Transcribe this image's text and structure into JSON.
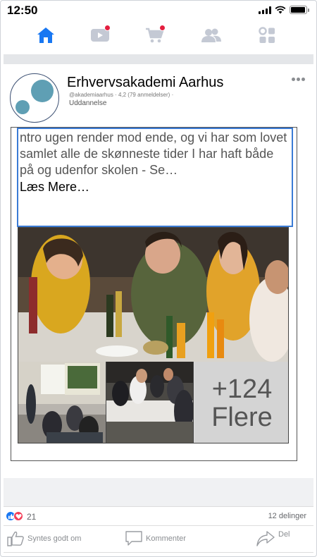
{
  "status_bar": {
    "time": "12:50",
    "battery_level": 0.95
  },
  "nav": {
    "items": [
      {
        "name": "home",
        "icon": "home-icon",
        "active": true,
        "badge": false
      },
      {
        "name": "video",
        "icon": "video-icon",
        "active": false,
        "badge": true
      },
      {
        "name": "marketplace",
        "icon": "cart-icon",
        "active": false,
        "badge": true
      },
      {
        "name": "groups",
        "icon": "groups-icon",
        "active": false,
        "badge": false
      },
      {
        "name": "menu",
        "icon": "menu-grid-icon",
        "active": false,
        "badge": false
      }
    ],
    "active_color": "#1877f2",
    "inactive_color": "#c4c9d4",
    "badge_color": "#e41e3f"
  },
  "post": {
    "page_name": "Erhvervsakademi Aarhus",
    "handle": "@akademiaarhus",
    "rating": "4,2 (79 anmeldelser)",
    "category": "Uddannelse",
    "text": "ntro ugen render mod ende, og vi har som lovet samlet alle de skønneste tider I har haft både på og udenfor skolen - Se…",
    "read_more": "Læs Mere…",
    "photos": {
      "more_count": "+124",
      "more_label": "Flere"
    }
  },
  "reactions": {
    "count": "21",
    "shares": "12 delinger"
  },
  "actions": {
    "like": "Syntes godt om",
    "comment": "Kommenter",
    "share": "Del"
  }
}
